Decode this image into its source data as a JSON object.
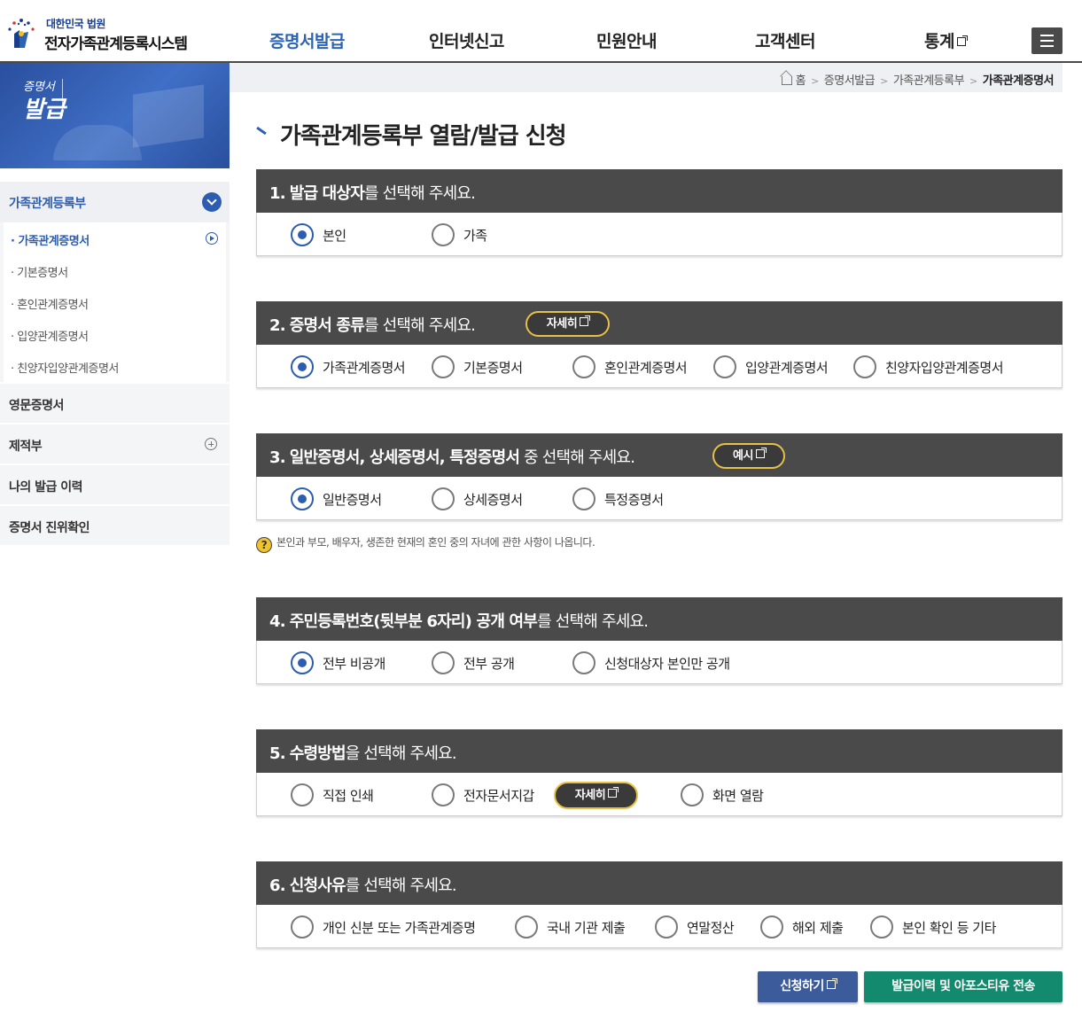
{
  "header": {
    "logo_sub": "대한민국 법원",
    "logo_main": "전자가족관계등록시스템",
    "nav": [
      "증명서발급",
      "인터넷신고",
      "민원안내",
      "고객센터",
      "통계"
    ],
    "active_color": "#2d63b5"
  },
  "sidebar": {
    "banner_small": "증명서",
    "banner_big": "발급",
    "head": "가족관계등록부",
    "sub_items": [
      "가족관계증명서",
      "기본증명서",
      "혼인관계증명서",
      "입양관계증명서",
      "친양자입양관계증명서"
    ],
    "items": [
      "영문증명서",
      "제적부",
      "나의 발급 이력",
      "증명서 진위확인"
    ]
  },
  "breadcrumb": [
    "홈",
    "증명서발급",
    "가족관계등록부",
    "가족관계증명서"
  ],
  "title": "가족관계등록부 열람/발급 신청",
  "sections": [
    {
      "num": "1.",
      "bold": "발급 대상자",
      "rest": "를 선택해 주세요.",
      "options": [
        {
          "label": "본인",
          "checked": true
        },
        {
          "label": "가족",
          "checked": false
        }
      ]
    },
    {
      "num": "2.",
      "bold": "증명서 종류",
      "rest": "를 선택해 주세요.",
      "pill": "자세히",
      "options": [
        {
          "label": "가족관계증명서",
          "checked": true
        },
        {
          "label": "기본증명서",
          "checked": false
        },
        {
          "label": "혼인관계증명서",
          "checked": false
        },
        {
          "label": "입양관계증명서",
          "checked": false
        },
        {
          "label": "친양자입양관계증명서",
          "checked": false
        }
      ]
    },
    {
      "num": "3.",
      "bold": "일반증명서, 상세증명서, 특정증명서",
      "rest": " 중 선택해 주세요.",
      "pill": "예시",
      "options": [
        {
          "label": "일반증명서",
          "checked": true
        },
        {
          "label": "상세증명서",
          "checked": false
        },
        {
          "label": "특정증명서",
          "checked": false
        }
      ]
    },
    {
      "num": "4.",
      "bold": "주민등록번호(뒷부분 6자리) 공개 여부",
      "rest": "를 선택해 주세요.",
      "options": [
        {
          "label": "전부 비공개",
          "checked": true
        },
        {
          "label": "전부 공개",
          "checked": false
        },
        {
          "label": "신청대상자 본인만 공개",
          "checked": false
        }
      ]
    },
    {
      "num": "5.",
      "bold": "수령방법",
      "rest": "을 선택해 주세요.",
      "inline_pill": "자세히",
      "options": [
        {
          "label": "직접 인쇄",
          "checked": false
        },
        {
          "label": "전자문서지갑",
          "checked": false
        },
        {
          "label": "화면 열람",
          "checked": false
        }
      ]
    },
    {
      "num": "6.",
      "bold": "신청사유",
      "rest": "를 선택해 주세요.",
      "options": [
        {
          "label": "개인 신분 또는 가족관계증명",
          "checked": false
        },
        {
          "label": "국내 기관 제출",
          "checked": false
        },
        {
          "label": "연말정산",
          "checked": false
        },
        {
          "label": "해외 제출",
          "checked": false
        },
        {
          "label": "본인 확인 등 기타",
          "checked": false
        }
      ]
    }
  ],
  "note": "본인과 부모, 배우자, 생존한 현재의 혼인 중의 자녀에 관한 사항이 나옵니다.",
  "buttons": {
    "apply": "신청하기",
    "send": "발급이력 및 아포스티유 전송"
  }
}
